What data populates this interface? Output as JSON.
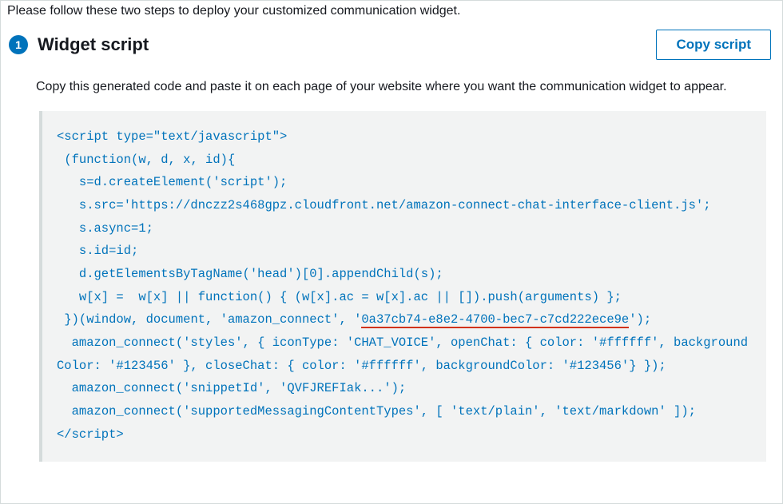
{
  "intro": "Please follow these two steps to deploy your customized communication widget.",
  "step": {
    "number": "1",
    "title": "Widget script",
    "copyButton": "Copy script",
    "description": "Copy this generated code and paste it on each page of your website where you want the communication widget to appear."
  },
  "code": {
    "line1": "<script type=\"text/javascript\">",
    "line2": " (function(w, d, x, id){",
    "line3": "   s=d.createElement('script');",
    "line4": "   s.src='https://dnczz2s468gpz.cloudfront.net/amazon-connect-chat-interface-client.js';",
    "line5": "   s.async=1;",
    "line6": "   s.id=id;",
    "line7": "   d.getElementsByTagName('head')[0].appendChild(s);",
    "line8": "   w[x] =  w[x] || function() { (w[x].ac = w[x].ac || []).push(arguments) };",
    "line9a": " })(window, document, 'amazon_connect', '",
    "line9id": "0a37cb74-e8e2-4700-bec7-c7cd222ece9e",
    "line9b": "');",
    "line10": "  amazon_connect('styles', { iconType: 'CHAT_VOICE', openChat: { color: '#ffffff', backgroundColor: '#123456' }, closeChat: { color: '#ffffff', backgroundColor: '#123456'} });",
    "line11": "  amazon_connect('snippetId', 'QVFJREFIak...');",
    "line12": "  amazon_connect('supportedMessagingContentTypes', [ 'text/plain', 'text/markdown' ]);",
    "line13": "</script>"
  }
}
